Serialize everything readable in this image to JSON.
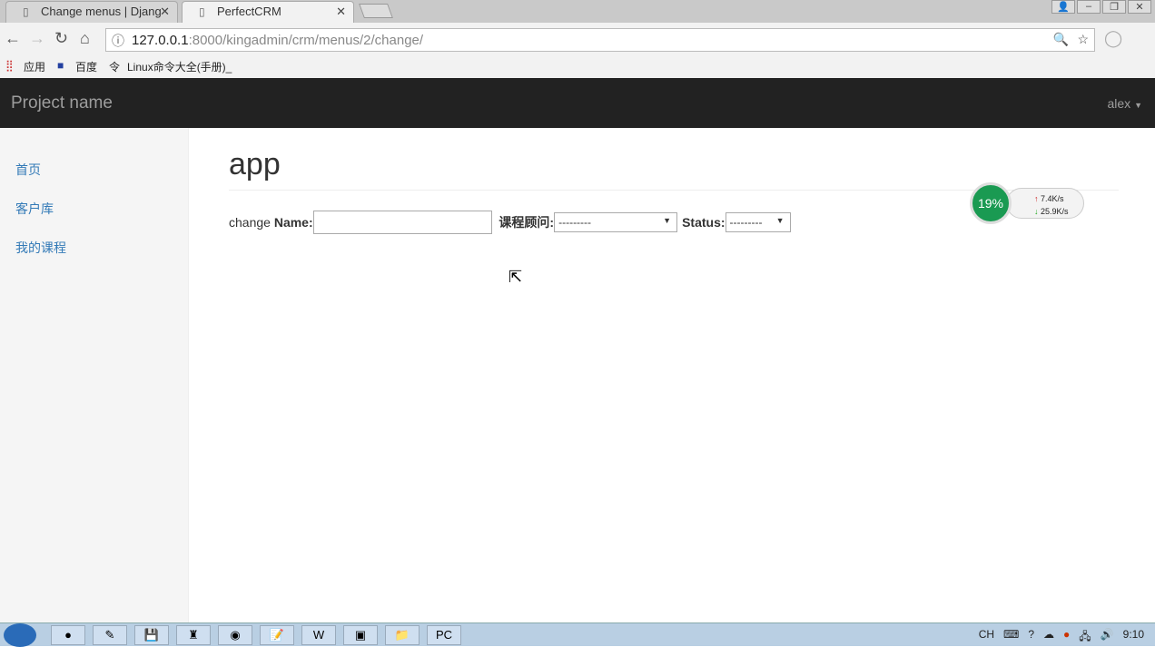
{
  "browser": {
    "tabs": [
      {
        "title": "Change menus | Djang"
      },
      {
        "title": "PerfectCRM",
        "active": true
      }
    ],
    "url_host": "127.0.0.1",
    "url_path": ":8000/kingadmin/crm/menus/2/change/",
    "bookmarks": [
      "应用",
      "百度",
      "Linux命令大全(手册)_"
    ]
  },
  "navbar": {
    "brand": "Project name",
    "user": "alex"
  },
  "sidebar": {
    "items": [
      {
        "label": "首页"
      },
      {
        "label": "客户库"
      },
      {
        "label": "我的课程"
      }
    ]
  },
  "main": {
    "title": "app",
    "form": {
      "prefix": "change",
      "name_label": "Name:",
      "name_value": "",
      "consultant_label": "课程顾问:",
      "consultant_value": "---------",
      "status_label": "Status:",
      "status_value": "---------"
    }
  },
  "widget": {
    "cpu": "19%",
    "up": "7.4K/s",
    "down": "25.9K/s"
  },
  "taskbar": {
    "lang": "CH",
    "time": "9:10"
  }
}
